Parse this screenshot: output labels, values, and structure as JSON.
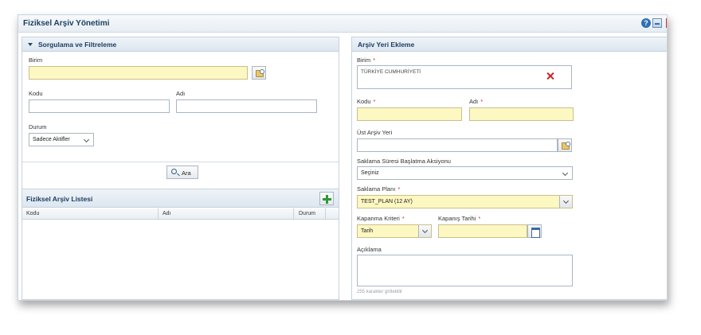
{
  "window": {
    "title": "Fiziksel Arşiv Yönetimi",
    "help_glyph": "?"
  },
  "filter_panel": {
    "title": "Sorgulama ve Filtreleme",
    "unit_label": "Birim",
    "code_label": "Kodu",
    "name_label": "Adı",
    "status_label": "Durum",
    "status_value": "Sadece Aktifler",
    "search_button": "Ara"
  },
  "list_panel": {
    "title": "Fiziksel Arşiv Listesi",
    "columns": [
      "Kodu",
      "Adı",
      "Durum"
    ]
  },
  "add_panel": {
    "title": "Arşiv Yeri Ekleme",
    "required_mark": "*",
    "unit_label": "Birim",
    "unit_value": "TÜRKİYE CUMHURİYETİ",
    "code_label": "Kodu",
    "name_label": "Adı",
    "parent_label": "Üst Arşiv Yeri",
    "retention_action_label": "Saklama Süresi Başlatma Aksiyonu",
    "retention_action_value": "Seçiniz",
    "retention_plan_label": "Saklama Planı",
    "retention_plan_value": "TEST_PLAN (12 AY)",
    "closing_criteria_label": "Kapanma Kriteri",
    "closing_criteria_value": "Tarih",
    "closing_date_label": "Kapanış Tarihi",
    "description_label": "Açıklama",
    "char_hint": "255 karakter girilebilir"
  },
  "colors": {
    "required_field_bg": "#fdf7c2",
    "header_text": "#1b3e63",
    "required_mark": "#c0392b"
  }
}
